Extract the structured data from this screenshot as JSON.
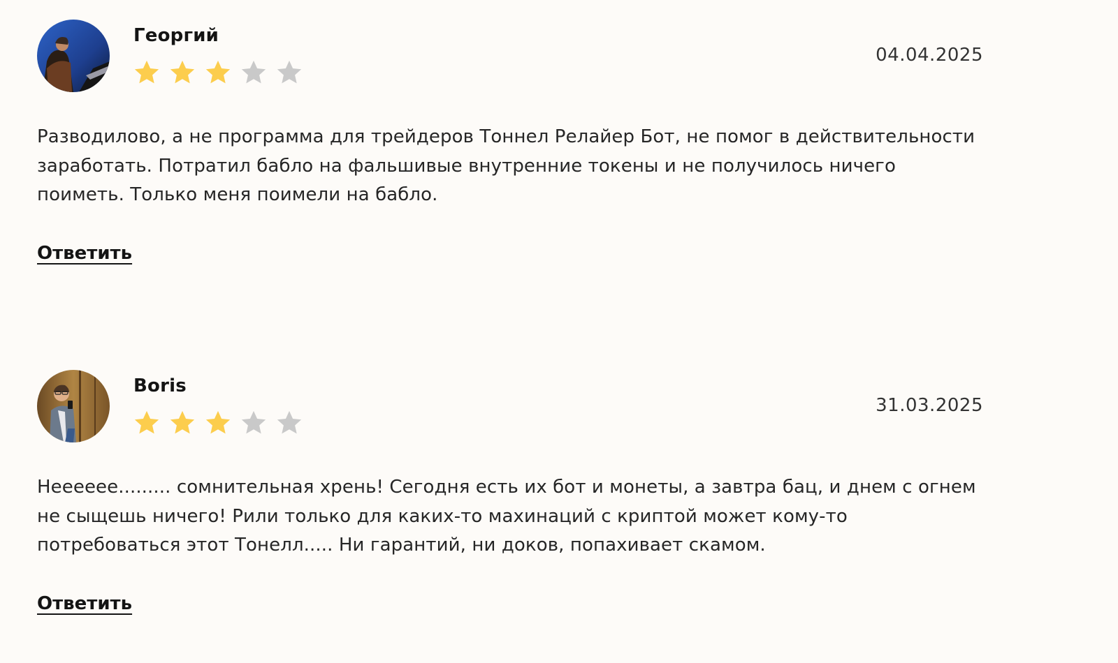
{
  "colors": {
    "star_filled": "#fccd4d",
    "star_empty": "#c9c9c9",
    "background": "#fdfbf8"
  },
  "reviews": [
    {
      "author": "Георгий",
      "date": "04.04.2025",
      "rating": 3,
      "max_rating": 5,
      "text": "Разводилово, а не программа для трейдеров Тоннел Релайер Бот, не помог в действительности заработать. Потратил бабло на фальшивые внутренние токены и не получилось ничего поиметь. Только меня поимели на бабло.",
      "reply_label": "Ответить"
    },
    {
      "author": "Boris",
      "date": "31.03.2025",
      "rating": 3,
      "max_rating": 5,
      "text": "Неееееe......... сомнительная хрень! Сегодня есть их бот и монеты, а завтра бац, и днем с огнем не сыщешь ничего! Рили только для каких-то махинаций с криптой может кому-то потребоваться этот Тонелл..... Ни гарантий, ни доков, попахивает скамом.",
      "reply_label": "Ответить"
    }
  ]
}
